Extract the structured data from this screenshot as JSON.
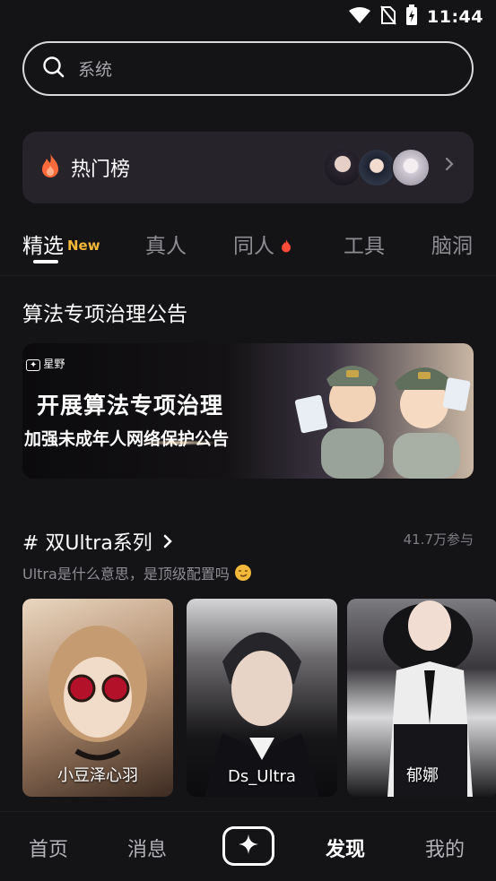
{
  "status_bar": {
    "time": "11:44"
  },
  "search": {
    "placeholder": "系统"
  },
  "hot_list": {
    "label": "热门榜"
  },
  "tabs": [
    {
      "label": "精选",
      "badge": "New"
    },
    {
      "label": "真人"
    },
    {
      "label": "同人"
    },
    {
      "label": "工具"
    },
    {
      "label": "脑洞"
    }
  ],
  "announcement": {
    "title": "算法专项治理公告",
    "banner_brand": "星野",
    "banner_line1": "开展算法专项治理",
    "banner_line2": "加强未成年人网络保护公告"
  },
  "topic": {
    "title": "# 双Ultra系列",
    "participants": "41.7万参与",
    "description": "Ultra是什么意思，是顶级配置吗",
    "cards": [
      {
        "name": "小豆泽心羽"
      },
      {
        "name": "Ds_Ultra"
      },
      {
        "name": "郁娜"
      }
    ]
  },
  "bottom_nav": [
    {
      "label": "首页"
    },
    {
      "label": "消息"
    },
    {
      "label": "发现"
    },
    {
      "label": "我的"
    }
  ],
  "colors": {
    "background": "#141316",
    "accent_new": "#f3b83a",
    "fire": "#ff6a3d"
  }
}
